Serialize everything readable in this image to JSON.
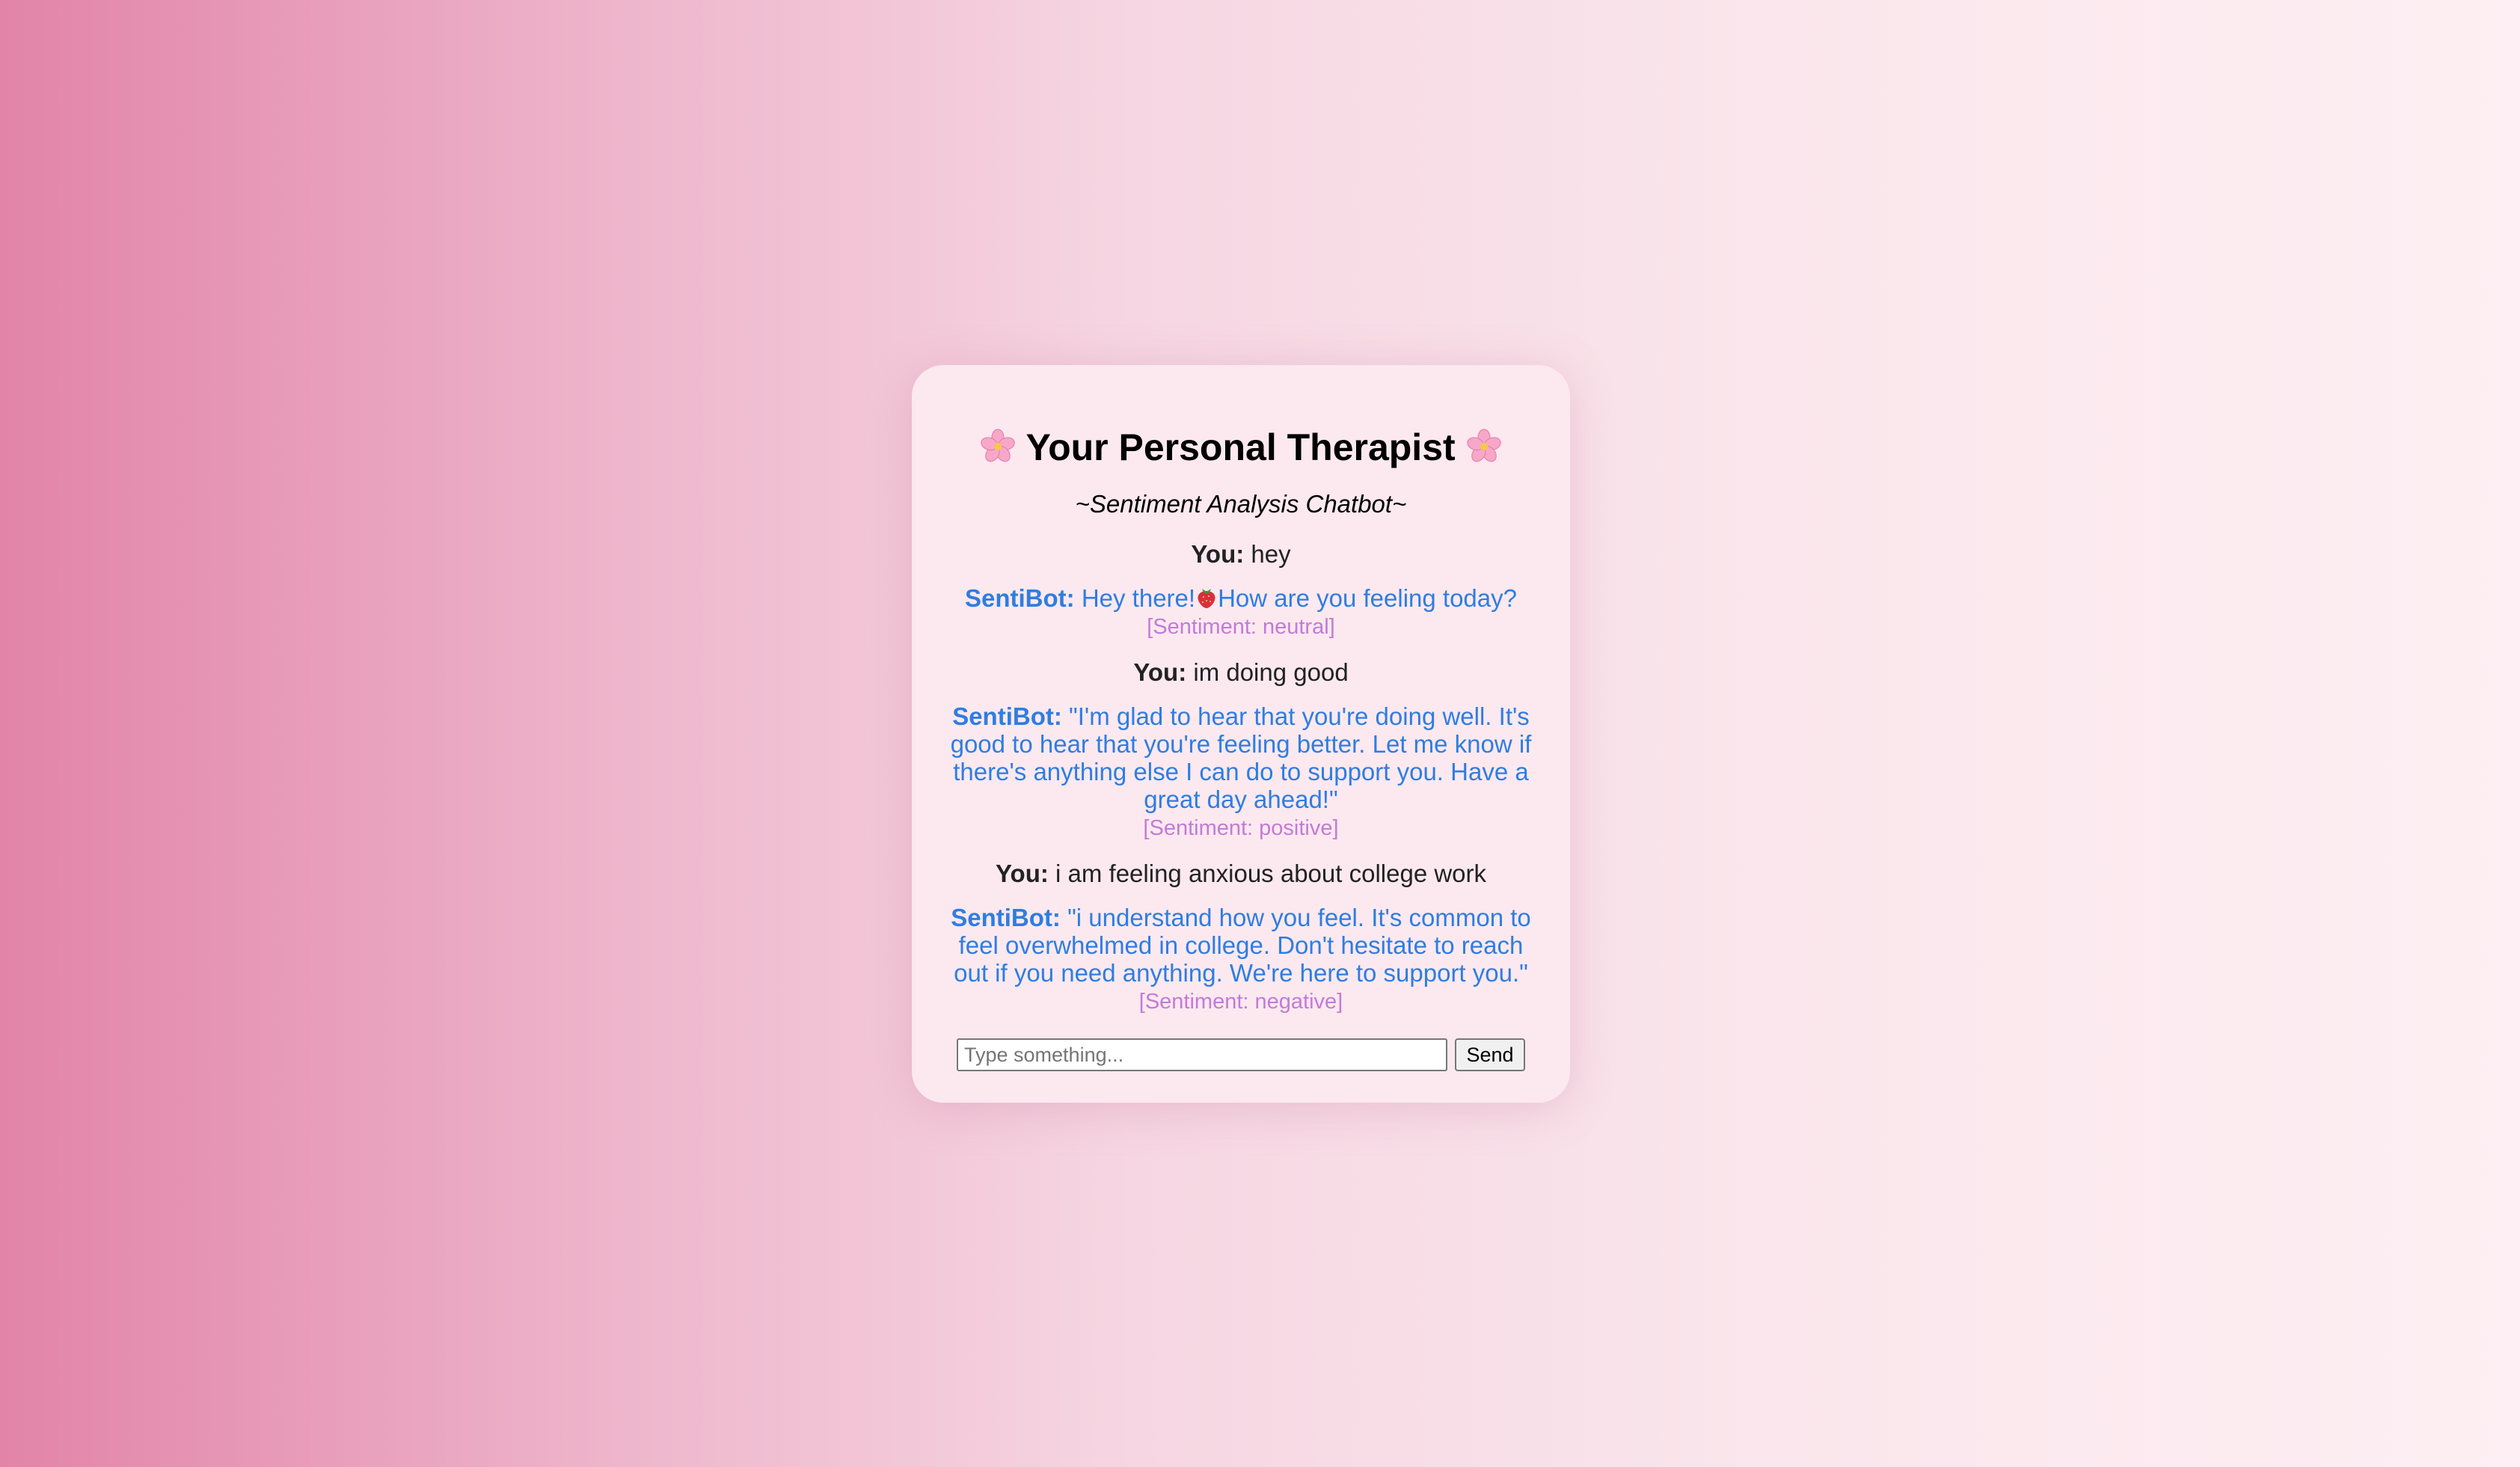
{
  "header": {
    "title": "Your Personal Therapist",
    "subtitle": "~Sentiment Analysis Chatbot~",
    "title_icon": "cherry-blossom-icon"
  },
  "colors": {
    "user_text": "#222222",
    "bot_text": "#2f7de1",
    "sentiment_text": "#c47ad8",
    "card_background": "#fbe9ef",
    "page_gradient_start": "#e284a8",
    "page_gradient_end": "#fdeff3"
  },
  "chat": {
    "user_label": "You:",
    "bot_label": "SentiBot:",
    "messages": [
      {
        "user": "hey"
      },
      {
        "bot_before_icon": "Hey there!",
        "bot_icon": "strawberry-icon",
        "bot_after_icon": "How are you feeling today?",
        "sentiment": "[Sentiment: neutral]"
      },
      {
        "user": "im doing good"
      },
      {
        "bot": "\"I'm glad to hear that you're doing well. It's good to hear that you're feeling better. Let me know if there's anything else I can do to support you. Have a great day ahead!\"",
        "sentiment": "[Sentiment: positive]"
      },
      {
        "user": "i am feeling anxious about college work"
      },
      {
        "bot": "\"i understand how you feel. It's common to feel overwhelmed in college. Don't hesitate to reach out if you need anything. We're here to support you.\"",
        "sentiment": "[Sentiment: negative]"
      }
    ]
  },
  "composer": {
    "placeholder": "Type something...",
    "value": "",
    "send_label": "Send"
  }
}
